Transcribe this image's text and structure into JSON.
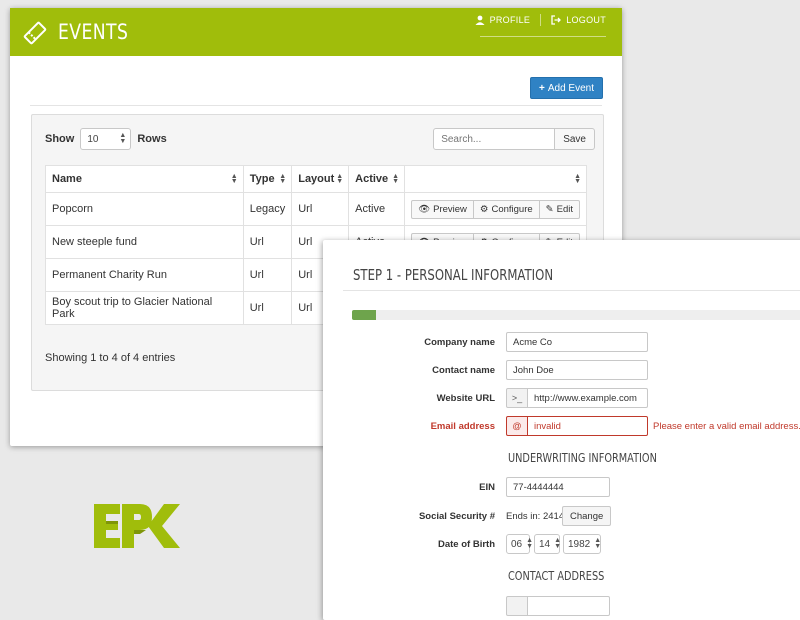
{
  "events_window": {
    "title": "EVENTS",
    "header_links": {
      "profile": "PROFILE",
      "logout": "LOGOUT"
    },
    "add_event_label": "Add Event",
    "show_label": "Show",
    "rows_per_page": "10",
    "rows_label": "Rows",
    "search_placeholder": "Search...",
    "save_label": "Save",
    "columns": [
      "Name",
      "Type",
      "Layout",
      "Active",
      ""
    ],
    "rows": [
      {
        "name": "Popcorn",
        "type": "Legacy",
        "layout": "Url",
        "active": "Active"
      },
      {
        "name": "New steeple fund",
        "type": "Url",
        "layout": "Url",
        "active": "Active"
      },
      {
        "name": "Permanent Charity Run",
        "type": "Url",
        "layout": "Url",
        "active": ""
      },
      {
        "name": "Boy scout trip to Glacier National Park",
        "type": "Url",
        "layout": "Url",
        "active": ""
      }
    ],
    "row_actions": {
      "preview": "Preview",
      "configure": "Configure",
      "edit": "Edit"
    },
    "showing_text": "Showing 1 to 4 of 4 entries",
    "accent_color": "#a0bd0b"
  },
  "form_window": {
    "step_title": "STEP 1 - PERSONAL INFORMATION",
    "progress_fraction": 0.05,
    "fields": {
      "company_name": {
        "label": "Company name",
        "value": "Acme Co"
      },
      "contact_name": {
        "label": "Contact name",
        "value": "John Doe"
      },
      "website_url": {
        "label": "Website URL",
        "addon": ">_",
        "value": "http://www.example.com"
      },
      "email_address": {
        "label": "Email address",
        "addon": "@",
        "value": "invalid",
        "error": "Please enter a valid email address."
      }
    },
    "underwriting_title": "UNDERWRITING INFORMATION",
    "ein": {
      "label": "EIN",
      "value": "77-4444444"
    },
    "ssn": {
      "label": "Social Security #",
      "text": "Ends in: 2414",
      "change_label": "Change"
    },
    "dob": {
      "label": "Date of Birth",
      "month": "06",
      "day": "14",
      "year": "1982"
    },
    "contact_address_title": "CONTACT ADDRESS",
    "error_color": "#c0392b",
    "progress_color": "#6ea44c"
  },
  "logo": {
    "text": "EPK",
    "color": "#a0bd0b"
  }
}
